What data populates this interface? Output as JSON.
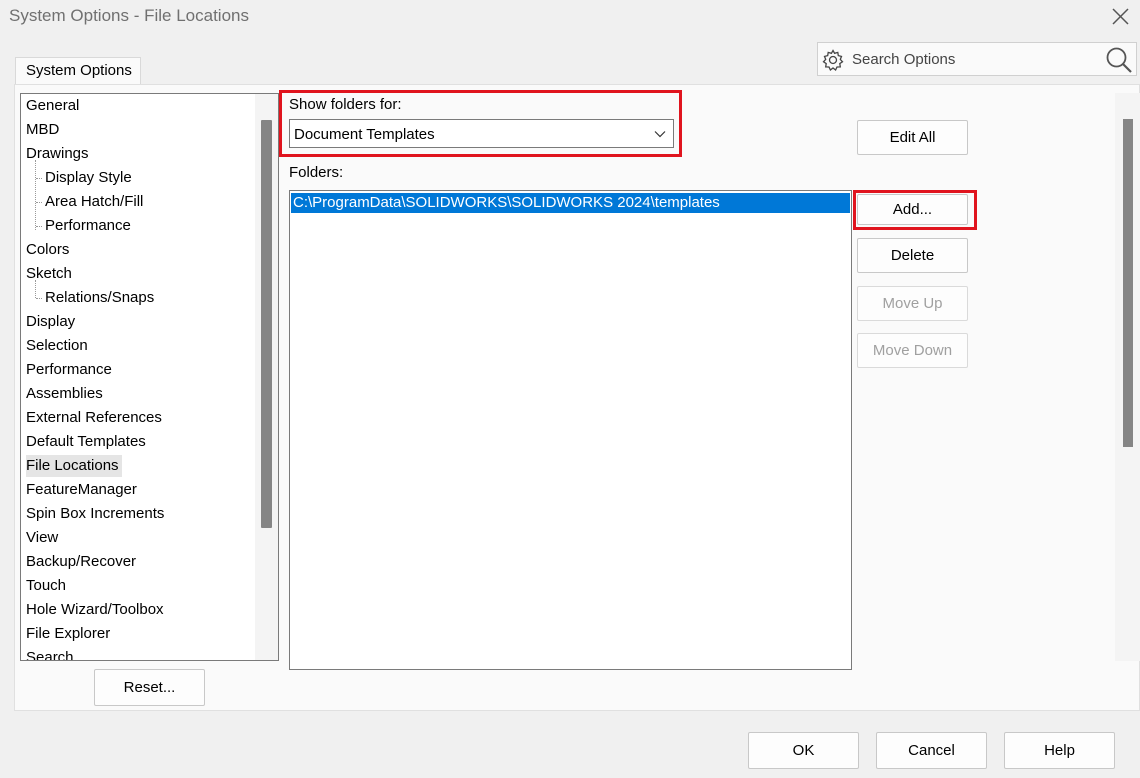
{
  "window": {
    "title": "System Options - File Locations"
  },
  "tabs": [
    {
      "label": "System Options"
    }
  ],
  "search": {
    "placeholder": "Search Options"
  },
  "tree": {
    "items": [
      {
        "label": "General",
        "level": 0
      },
      {
        "label": "MBD",
        "level": 0
      },
      {
        "label": "Drawings",
        "level": 0
      },
      {
        "label": "Display Style",
        "level": 1
      },
      {
        "label": "Area Hatch/Fill",
        "level": 1
      },
      {
        "label": "Performance",
        "level": 1
      },
      {
        "label": "Colors",
        "level": 0
      },
      {
        "label": "Sketch",
        "level": 0
      },
      {
        "label": "Relations/Snaps",
        "level": 1
      },
      {
        "label": "Display",
        "level": 0
      },
      {
        "label": "Selection",
        "level": 0
      },
      {
        "label": "Performance",
        "level": 0
      },
      {
        "label": "Assemblies",
        "level": 0
      },
      {
        "label": "External References",
        "level": 0
      },
      {
        "label": "Default Templates",
        "level": 0
      },
      {
        "label": "File Locations",
        "level": 0,
        "selected": true
      },
      {
        "label": "FeatureManager",
        "level": 0
      },
      {
        "label": "Spin Box Increments",
        "level": 0
      },
      {
        "label": "View",
        "level": 0
      },
      {
        "label": "Backup/Recover",
        "level": 0
      },
      {
        "label": "Touch",
        "level": 0
      },
      {
        "label": "Hole Wizard/Toolbox",
        "level": 0
      },
      {
        "label": "File Explorer",
        "level": 0
      },
      {
        "label": "Search",
        "level": 0
      }
    ]
  },
  "main": {
    "show_folders_label": "Show folders for:",
    "show_folders_value": "Document Templates",
    "folders_label": "Folders:",
    "folders": [
      "C:\\ProgramData\\SOLIDWORKS\\SOLIDWORKS 2024\\templates"
    ],
    "buttons": {
      "edit_all": "Edit All",
      "add": "Add...",
      "delete": "Delete",
      "move_up": "Move Up",
      "move_down": "Move Down"
    }
  },
  "footer": {
    "reset": "Reset...",
    "ok": "OK",
    "cancel": "Cancel",
    "help": "Help"
  },
  "colors": {
    "highlight": "#e0141e",
    "selection": "#0078d7"
  },
  "icons": {
    "close": "close-icon",
    "search_gear": "gear-icon",
    "search": "search-icon",
    "dropdown": "chevron-down-icon"
  }
}
